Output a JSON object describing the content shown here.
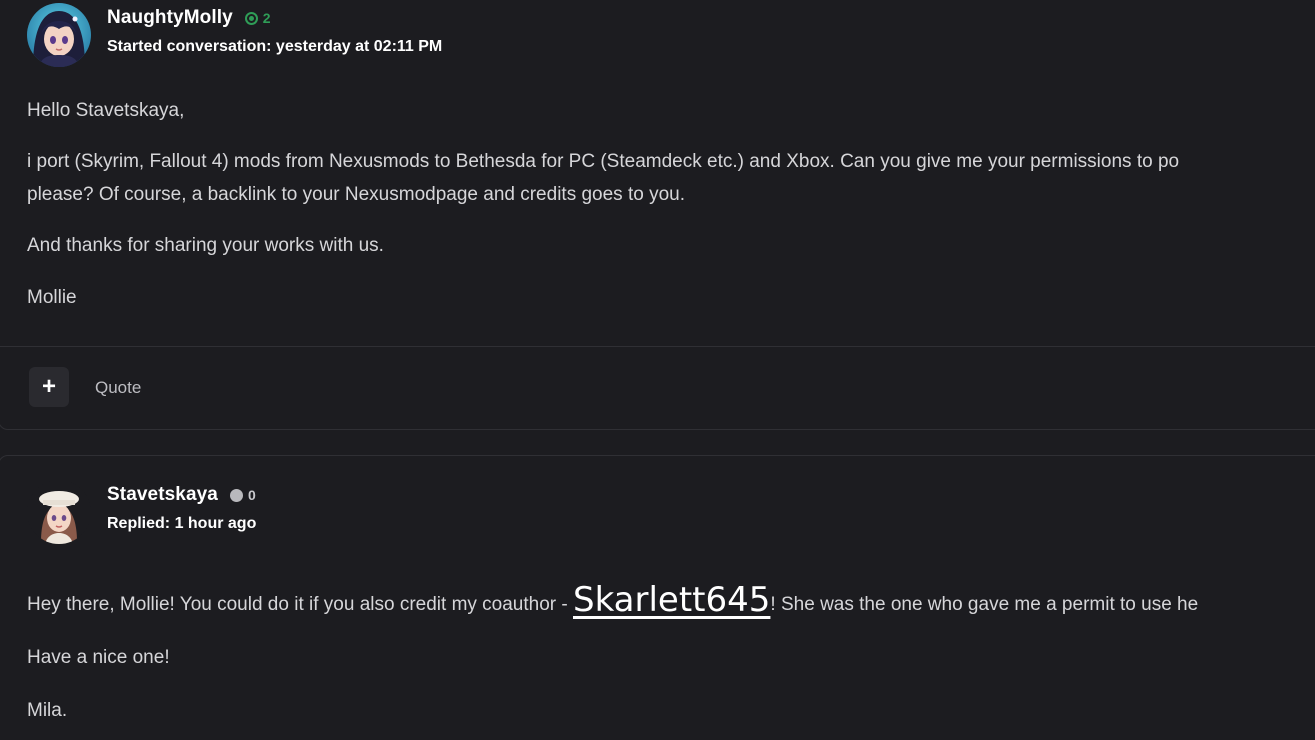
{
  "posts": [
    {
      "username": "NaughtyMolly",
      "reputation": "2",
      "subline": "Started conversation: yesterday at 02:11 PM",
      "paragraphs": [
        "Hello Stavetskaya,",
        "i port (Skyrim, Fallout 4) mods from Nexusmods to Bethesda for PC (Steamdeck etc.) and Xbox. Can you give me your permissions to po",
        "please? Of course, a backlink to your Nexusmodpage and credits goes to you.",
        "And thanks for sharing your works with us.",
        "Mollie"
      ],
      "actions": {
        "plus_label": "+",
        "quote_label": "Quote"
      }
    },
    {
      "username": "Stavetskaya",
      "reputation": "0",
      "subline": "Replied: 1 hour ago",
      "reply_line": {
        "before": "Hey there, Mollie! You could do it if you also credit my coauthor - ",
        "link": "Skarlett645",
        "after": "! She was the one who gave me a permit to use he"
      },
      "paragraphs": [
        "Have a nice one!",
        "Mila."
      ]
    }
  ],
  "colors": {
    "background": "#1c1c20",
    "border": "#2f2f34",
    "reputation_positive": "#2f9d57",
    "reputation_neutral": "#b9b9bd"
  },
  "icons": {
    "avatar_1": "anime-girl-avatar",
    "avatar_2": "beret-girl-avatar",
    "reputation_positive": "green-ring-icon",
    "reputation_neutral": "grey-dot-icon"
  }
}
